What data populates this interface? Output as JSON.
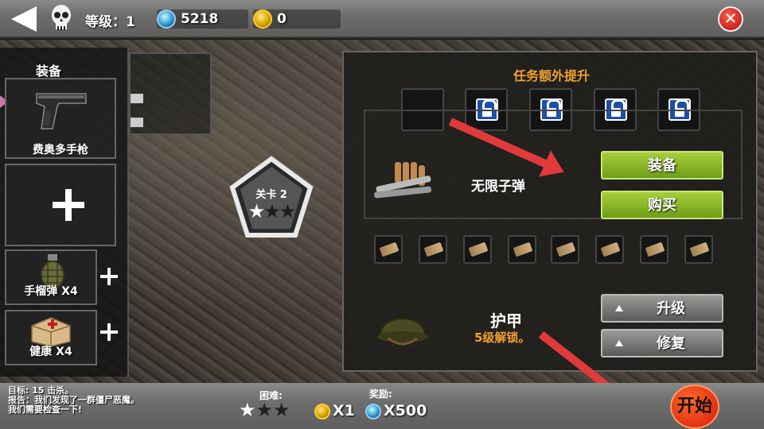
{
  "topbar": {
    "level_text": "等级：1",
    "gems": "5218",
    "coins": "0",
    "icons": [
      "back-arrow-icon",
      "skull-icon",
      "gem-icon",
      "coin-icon",
      "close-icon"
    ]
  },
  "left_panel": {
    "title": "装备",
    "weapon_label": "费奥多手枪",
    "grenade_label": "手榴弹 X4",
    "health_label": "健康 X4"
  },
  "stage": {
    "label": "关卡 2",
    "stars": "★★★",
    "stars_earned": 1,
    "stars_total": 3
  },
  "right_panel": {
    "bonus_title": "任务额外提升",
    "ammo_label": "无限子弹",
    "equip_button": "装备",
    "buy_button": "购买",
    "armor_title": "护甲",
    "armor_subtitle": "5级解锁。",
    "upgrade_button": "升级",
    "repair_button": "修复",
    "locked_slots": 4
  },
  "bottom": {
    "goal_label": "目标:",
    "goal_count": "15",
    "goal_suffix": "击杀。",
    "goal_text_1": "报告：我们发现了一群僵尸恶魔。",
    "goal_text_2": "我们需要检查一下!",
    "difficulty_label": "困难:",
    "difficulty_stars": "★★★",
    "reward_label": "奖励:",
    "reward_coins": "X1",
    "reward_gems": "X500",
    "start_button": "开始"
  },
  "colors": {
    "accent_orange": "#f0a030",
    "button_green": "#8ab82a",
    "start_red": "#e02810",
    "arrow_red": "#e23a3a"
  }
}
